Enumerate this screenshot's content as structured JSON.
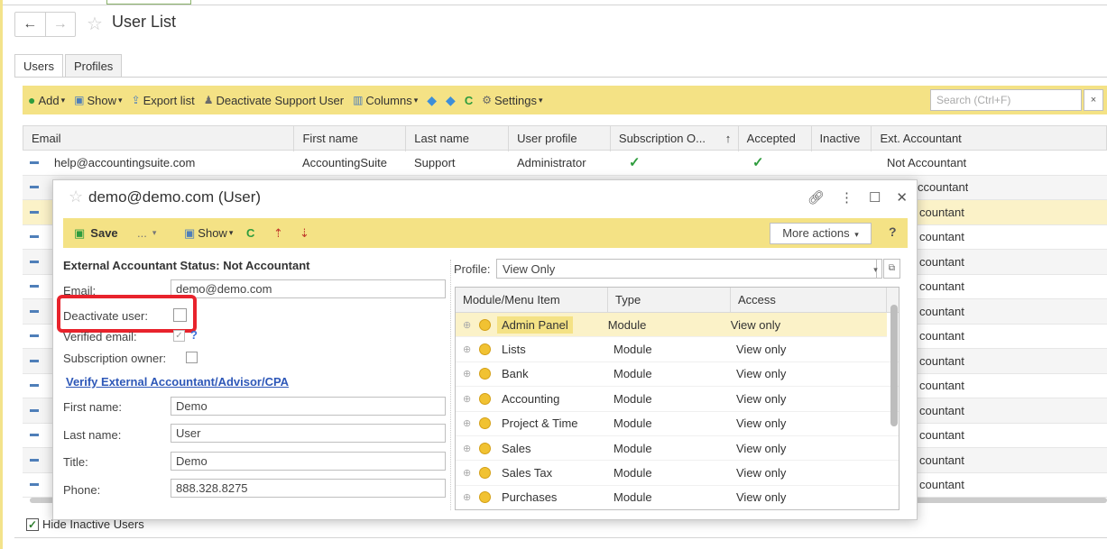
{
  "window": {
    "title": "User List"
  },
  "tabs": [
    "Users",
    "Profiles"
  ],
  "toolbar": {
    "add": "Add",
    "show": "Show",
    "export_list": "Export list",
    "deactivate_support_user": "Deactivate Support User",
    "columns": "Columns",
    "settings": "Settings",
    "search_placeholder": "Search (Ctrl+F)",
    "search_clear": "×"
  },
  "grid": {
    "columns": [
      "Email",
      "First name",
      "Last name",
      "User profile",
      "Subscription O...",
      "↑",
      "Accepted",
      "Inactive",
      "Ext. Accountant"
    ],
    "first_row": {
      "email": "help@accountingsuite.com",
      "first_name": "AccountingSuite",
      "last_name": "Support",
      "user_profile": "Administrator",
      "subscription_owner": "✓",
      "accepted": "✓",
      "ext_accountant": "Not Accountant"
    },
    "partial_ext_accountant": [
      "ccountant",
      "countant",
      "countant",
      "countant",
      "countant",
      "countant",
      "countant",
      "countant",
      "countant",
      "countant",
      "countant",
      "countant",
      "countant"
    ]
  },
  "footer": {
    "hide_inactive_label": "Hide Inactive Users"
  },
  "dialog": {
    "title": "demo@demo.com (User)",
    "toolbar": {
      "save": "Save",
      "more": "...",
      "show": "Show",
      "more_actions": "More actions",
      "help": "?"
    },
    "ext_status": "External Accountant Status: Not Accountant",
    "fields": {
      "email_label": "Email:",
      "email_value": "demo@demo.com",
      "deactivate_label": "Deactivate user:",
      "verified_label": "Verified email:",
      "verified_help": "?",
      "subscription_label": "Subscription owner:",
      "verify_link": "Verify External Accountant/Advisor/CPA",
      "first_name_label": "First name:",
      "first_name_value": "Demo",
      "last_name_label": "Last name:",
      "last_name_value": "User",
      "title_label": "Title:",
      "title_value": "Demo",
      "phone_label": "Phone:",
      "phone_value": "888.328.8275"
    },
    "profile": {
      "label": "Profile:",
      "value": "View Only"
    },
    "module_grid": {
      "columns": [
        "Module/Menu Item",
        "Type",
        "Access"
      ],
      "rows": [
        {
          "name": "Admin Panel",
          "type": "Module",
          "access": "View only"
        },
        {
          "name": "Lists",
          "type": "Module",
          "access": "View only"
        },
        {
          "name": "Bank",
          "type": "Module",
          "access": "View only"
        },
        {
          "name": "Accounting",
          "type": "Module",
          "access": "View only"
        },
        {
          "name": "Project & Time",
          "type": "Module",
          "access": "View only"
        },
        {
          "name": "Sales",
          "type": "Module",
          "access": "View only"
        },
        {
          "name": "Sales Tax",
          "type": "Module",
          "access": "View only"
        },
        {
          "name": "Purchases",
          "type": "Module",
          "access": "View only"
        }
      ]
    }
  },
  "colors": {
    "toolbar_yellow": "#f4e285",
    "selection": "#fbf2c8",
    "highlight_red": "#e8232c",
    "link_blue": "#2e58b8"
  }
}
